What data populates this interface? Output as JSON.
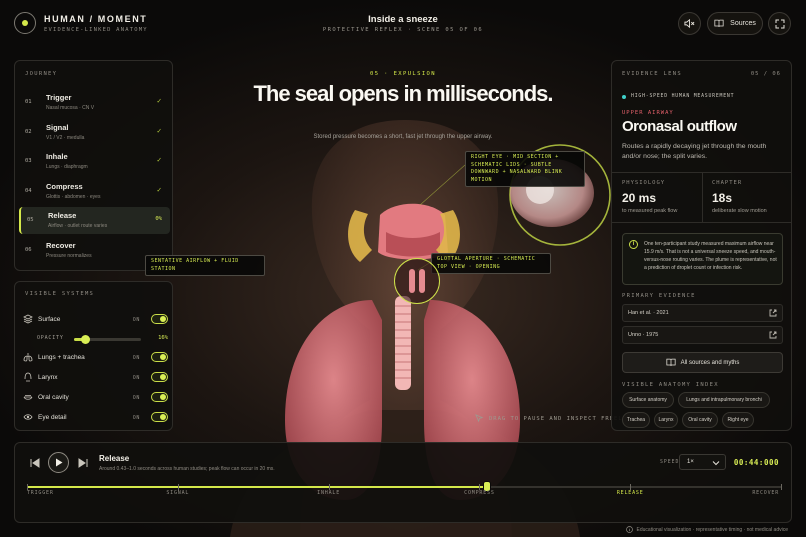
{
  "header": {
    "brand_title": "HUMAN / MOMENT",
    "brand_subtitle": "EVIDENCE-LINKED ANATOMY",
    "scene_title": "Inside a sneeze",
    "scene_subtitle": "PROTECTIVE REFLEX · SCENE 05 OF 06",
    "sources_label": "Sources",
    "mute_icon": "speaker-mute-icon",
    "sources_icon": "book-icon",
    "expand_icon": "expand-icon"
  },
  "journey": {
    "label": "JOURNEY",
    "steps": [
      {
        "num": "01",
        "title": "Trigger",
        "sub": "Nasal mucosa · CN V",
        "status": "done"
      },
      {
        "num": "02",
        "title": "Signal",
        "sub": "V1 / V2 · medulla",
        "status": "done"
      },
      {
        "num": "03",
        "title": "Inhale",
        "sub": "Lungs · diaphragm",
        "status": "done"
      },
      {
        "num": "04",
        "title": "Compress",
        "sub": "Glottis · abdomen · eyes",
        "status": "done"
      },
      {
        "num": "05",
        "title": "Release",
        "sub": "Airflow · outlet route varies",
        "status": "active",
        "progress": "0%"
      },
      {
        "num": "06",
        "title": "Recover",
        "sub": "Pressure normalizes",
        "status": "upcoming"
      }
    ]
  },
  "systems": {
    "label": "VISIBLE SYSTEMS",
    "on_label": "ON",
    "opacity_label": "OPACITY",
    "opacity_value": "16%",
    "opacity_fraction": 0.16,
    "items": [
      {
        "label": "Surface",
        "icon": "layers-icon",
        "on": true
      },
      {
        "label": "Lungs + trachea",
        "icon": "lungs-icon",
        "on": true
      },
      {
        "label": "Larynx",
        "icon": "larynx-icon",
        "on": true
      },
      {
        "label": "Oral cavity",
        "icon": "mouth-icon",
        "on": true
      },
      {
        "label": "Eye detail",
        "icon": "eye-icon",
        "on": true
      }
    ]
  },
  "stage": {
    "eyebrow": "05 · EXPULSION",
    "headline": "The seal opens in milliseconds.",
    "subhead": "Stored pressure becomes a short, fast jet through the upper airway.",
    "callout_eye": "RIGHT EYE · MID SECTION + SCHEMATIC LIDS · SUBTLE DOWNWARD + NASALWARD BLINK MOTION",
    "callout_glottis": "GLOTTAL APERTURE · SCHEMATIC TOP VIEW · OPENING",
    "callout_airflow": "SENTATIVE AIRFLOW + FLUID STATION",
    "drag_hint": "DRAG TO PAUSE AND INSPECT FREELY"
  },
  "evidence": {
    "label": "EVIDENCE LENS",
    "count": "05 / 06",
    "measurement_tag": "HIGH-SPEED HUMAN MEASUREMENT",
    "kicker": "UPPER AIRWAY",
    "title": "Oronasal outflow",
    "description": "Routes a rapidly decaying jet through the mouth and/or nose; the split varies.",
    "stats": [
      {
        "label": "PHYSIOLOGY",
        "value": "20 ms",
        "sub": "to measured peak flow"
      },
      {
        "label": "CHAPTER",
        "value": "18s",
        "sub": "deliberate slow motion"
      }
    ],
    "note": "One ten-participant study measured maximum airflow near 15.9 m/s. That is not a universal sneeze speed, and mouth-versus-nose routing varies. The plume is representative, not a prediction of droplet count or infection risk.",
    "primary_label": "PRIMARY EVIDENCE",
    "sources": [
      "Han et al. · 2021",
      "Unno · 1975"
    ],
    "all_sources_label": "All sources and myths",
    "index_label": "VISIBLE ANATOMY INDEX",
    "index_chips": [
      "Surface anatomy",
      "Lungs and intrapulmonary bronchi",
      "Trachea",
      "Larynx",
      "Oral cavity",
      "Right eye"
    ]
  },
  "transport": {
    "title": "Release",
    "description": "Around 0.43–1.0 seconds across human studies; peak flow can occur in 20 ms.",
    "speed_label": "SPEED",
    "speed_value": "1×",
    "timecode": "00:44:000",
    "progress_fraction": 0.61,
    "phases": [
      "TRIGGER",
      "SIGNAL",
      "INHALE",
      "COMPRESS",
      "RELEASE",
      "RECOVER"
    ],
    "current_phase": "RELEASE"
  },
  "footer": {
    "note": "Educational visualization · representative timing · not medical advice"
  },
  "colors": {
    "accent": "#d4e84a",
    "tissue": "#e58b90",
    "warning": "#e2606a",
    "measure": "#3fd0c9",
    "background": "#0b0a09"
  }
}
